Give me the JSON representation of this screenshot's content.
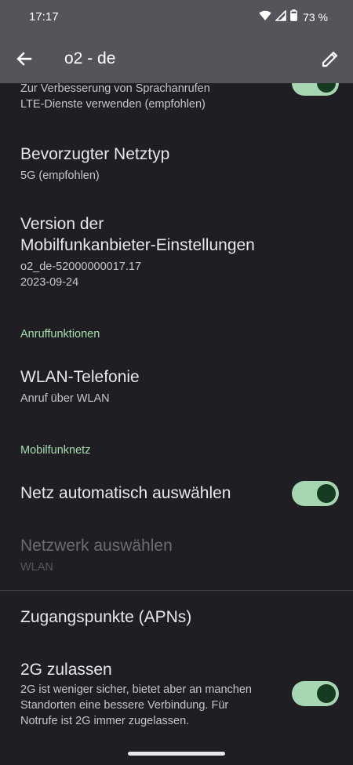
{
  "status": {
    "time": "17:17",
    "battery": "73 %"
  },
  "appbar": {
    "title": "o2 - de"
  },
  "items": {
    "volte_sub_1": "Zur Verbesserung von Sprachanrufen",
    "volte_sub_2": "LTE-Dienste verwenden (empfohlen)",
    "preferred_title": "Bevorzugter Netztyp",
    "preferred_sub": "5G (empfohlen)",
    "version_title_1": "Version der",
    "version_title_2": "Mobilfunkanbieter-Einstellungen",
    "version_sub_1": "o2_de-52000000017.17",
    "version_sub_2": "2023-09-24",
    "wlan_title": "WLAN-Telefonie",
    "wlan_sub": "Anruf über WLAN",
    "auto_title": "Netz automatisch auswählen",
    "select_title": "Netzwerk auswählen",
    "select_sub": "WLAN",
    "apn_title": "Zugangspunkte (APNs)",
    "twog_title": "2G zulassen",
    "twog_sub_1": "2G ist weniger sicher, bietet aber an manchen",
    "twog_sub_2": "Standorten eine bessere Verbindung. Für",
    "twog_sub_3": "Notrufe ist 2G immer zugelassen."
  },
  "sections": {
    "calls": "Anruffunktionen",
    "mobile": "Mobilfunknetz"
  },
  "toggles": {
    "volte": true,
    "auto_select": true,
    "allow_2g": true
  },
  "colors": {
    "background": "#1f1f23",
    "header": "#55545a",
    "accent_green": "#a6dcb0",
    "toggle_track": "#a7d7b2",
    "toggle_knob": "#153b20"
  },
  "icons": {
    "back": "arrow-back-icon",
    "edit": "pencil-icon",
    "wifi": "wifi-icon",
    "signal": "signal-icon",
    "battery": "battery-icon"
  }
}
